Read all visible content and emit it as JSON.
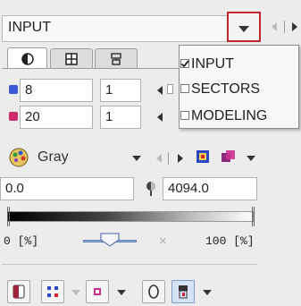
{
  "header": {
    "select_value": "INPUT"
  },
  "tabs": [
    {
      "icon": "contrast-icon"
    },
    {
      "icon": "grid-icon"
    },
    {
      "icon": "layout-icon"
    }
  ],
  "slice_rows": [
    {
      "value": "8",
      "step": "1"
    },
    {
      "value": "20",
      "step": "1"
    }
  ],
  "dropdown_menu": {
    "items": [
      {
        "label": "INPUT",
        "checked": true
      },
      {
        "label": "SECTORS",
        "checked": false
      },
      {
        "label": "MODELING",
        "checked": false
      }
    ]
  },
  "colormap": {
    "name": "Gray"
  },
  "range": {
    "min": "0.0",
    "max": "4094.0"
  },
  "threshold": {
    "low_label": "0 [%]",
    "x_label": "×",
    "high_label": "100 [%]"
  },
  "colors": {
    "accent": "#c0262c",
    "slice_icon": "#3d5bd9",
    "slice_icon2": "#cc2a6a"
  }
}
